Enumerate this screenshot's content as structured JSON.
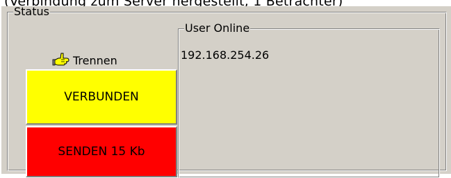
{
  "window": {
    "title": "(Verbindung zum Server hergestellt, 1 Betrachter)"
  },
  "status_group": {
    "label": "Status",
    "disconnect_button": {
      "label": "Trennen",
      "icon": "pointing-hand-icon"
    },
    "connection_state": {
      "label": "VERBUNDEN",
      "color": "#ffff00"
    },
    "send_state": {
      "label": "SENDEN 15 Kb",
      "color": "#ff0000"
    }
  },
  "users_group": {
    "label": "User Online",
    "users": [
      "192.168.254.26"
    ]
  }
}
